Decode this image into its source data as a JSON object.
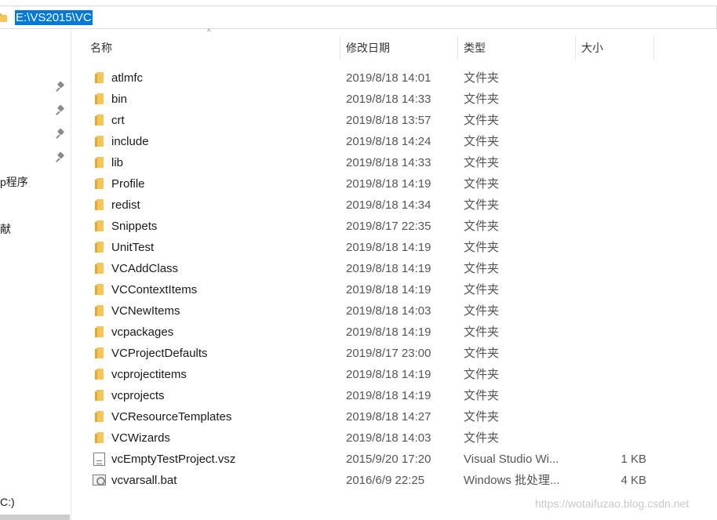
{
  "address": {
    "path": "E:\\VS2015\\VC"
  },
  "nav": {
    "items": [
      "p程序",
      "献",
      "C:)"
    ]
  },
  "columns": {
    "name": "名称",
    "modified": "修改日期",
    "type": "类型",
    "size": "大小",
    "sort_indicator": "^"
  },
  "files": [
    {
      "name": "atlmfc",
      "modified": "2019/8/18 14:01",
      "type": "文件夹",
      "size": "",
      "icon": "folder-icon"
    },
    {
      "name": "bin",
      "modified": "2019/8/18 14:33",
      "type": "文件夹",
      "size": "",
      "icon": "folder-icon"
    },
    {
      "name": "crt",
      "modified": "2019/8/18 13:57",
      "type": "文件夹",
      "size": "",
      "icon": "folder-icon"
    },
    {
      "name": "include",
      "modified": "2019/8/18 14:24",
      "type": "文件夹",
      "size": "",
      "icon": "folder-icon"
    },
    {
      "name": "lib",
      "modified": "2019/8/18 14:33",
      "type": "文件夹",
      "size": "",
      "icon": "folder-icon"
    },
    {
      "name": "Profile",
      "modified": "2019/8/18 14:19",
      "type": "文件夹",
      "size": "",
      "icon": "folder-icon"
    },
    {
      "name": "redist",
      "modified": "2019/8/18 14:34",
      "type": "文件夹",
      "size": "",
      "icon": "folder-icon"
    },
    {
      "name": "Snippets",
      "modified": "2019/8/17 22:35",
      "type": "文件夹",
      "size": "",
      "icon": "folder-icon"
    },
    {
      "name": "UnitTest",
      "modified": "2019/8/18 14:19",
      "type": "文件夹",
      "size": "",
      "icon": "folder-icon"
    },
    {
      "name": "VCAddClass",
      "modified": "2019/8/18 14:19",
      "type": "文件夹",
      "size": "",
      "icon": "folder-icon"
    },
    {
      "name": "VCContextItems",
      "modified": "2019/8/18 14:19",
      "type": "文件夹",
      "size": "",
      "icon": "folder-icon"
    },
    {
      "name": "VCNewItems",
      "modified": "2019/8/18 14:03",
      "type": "文件夹",
      "size": "",
      "icon": "folder-icon"
    },
    {
      "name": "vcpackages",
      "modified": "2019/8/18 14:19",
      "type": "文件夹",
      "size": "",
      "icon": "folder-icon"
    },
    {
      "name": "VCProjectDefaults",
      "modified": "2019/8/17 23:00",
      "type": "文件夹",
      "size": "",
      "icon": "folder-icon"
    },
    {
      "name": "vcprojectitems",
      "modified": "2019/8/18 14:19",
      "type": "文件夹",
      "size": "",
      "icon": "folder-icon"
    },
    {
      "name": "vcprojects",
      "modified": "2019/8/18 14:19",
      "type": "文件夹",
      "size": "",
      "icon": "folder-icon"
    },
    {
      "name": "VCResourceTemplates",
      "modified": "2019/8/18 14:27",
      "type": "文件夹",
      "size": "",
      "icon": "folder-icon"
    },
    {
      "name": "VCWizards",
      "modified": "2019/8/18 14:03",
      "type": "文件夹",
      "size": "",
      "icon": "folder-icon"
    },
    {
      "name": "vcEmptyTestProject.vsz",
      "modified": "2015/9/20 17:20",
      "type": "Visual Studio Wi...",
      "size": "1 KB",
      "icon": "document-icon"
    },
    {
      "name": "vcvarsall.bat",
      "modified": "2016/6/9 22:25",
      "type": "Windows 批处理...",
      "size": "4 KB",
      "icon": "batch-file-icon"
    }
  ],
  "watermark": "https://wotaifuzao.blog.csdn.net"
}
